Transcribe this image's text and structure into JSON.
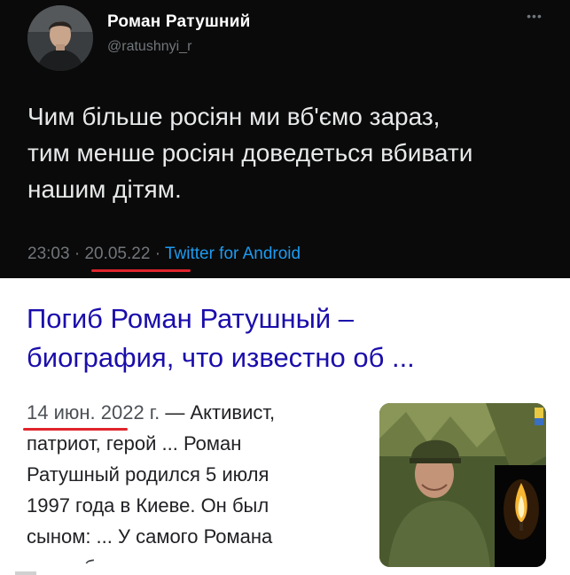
{
  "tweet": {
    "display_name": "Роман Ратушний",
    "handle": "@ratushnyi_r",
    "more_icon": "ellipsis-icon",
    "text_lines": [
      "Чим більше росіян ми вб'ємо зараз,",
      "тим менше росіян доведеться вбивати",
      "нашим дітям."
    ],
    "time": "23:03",
    "separator": "·",
    "date": "20.05.22",
    "source": "Twitter for Android"
  },
  "result": {
    "title_lines": [
      "Погиб Роман Ратушный –",
      "биография, что известно об ..."
    ],
    "date": "14 июн. 2022 г.",
    "snippet_first": " — Активист,",
    "snippet_lines": [
      "патриот, герой ... Роман",
      "Ратушный родился 5 июля",
      "1997 года в Киеве. Он был",
      "сыном: ... У самого Романа"
    ],
    "snippet_cut": "также был ...",
    "thumbnail": "soldier-photo-with-candle"
  },
  "colors": {
    "tweet_bg": "#0a0a0a",
    "twitter_blue": "#1d9bf0",
    "link_blue": "#1a0dab",
    "highlight_red": "#e0242c"
  }
}
